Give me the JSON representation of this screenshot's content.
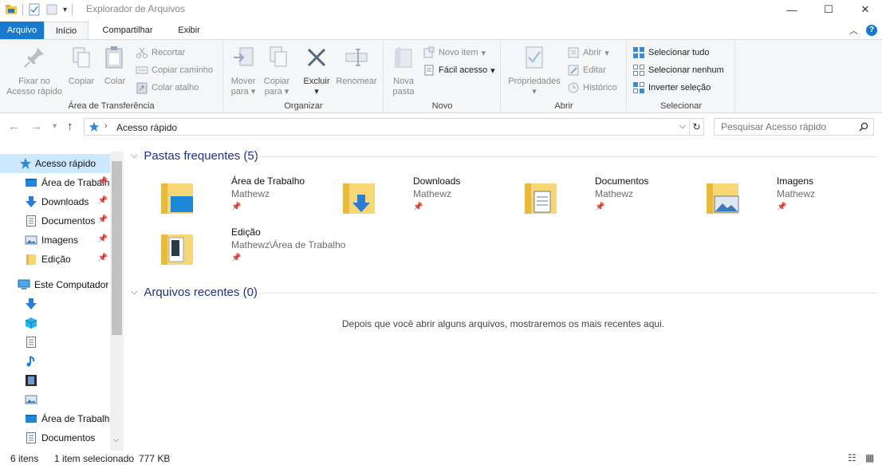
{
  "window": {
    "title": "Explorador de Arquivos",
    "minimize": "—",
    "maximize": "☐",
    "close": "✕"
  },
  "ribbon_tabs": {
    "file": "Arquivo",
    "home": "Início",
    "share": "Compartilhar",
    "view": "Exibir"
  },
  "ribbon": {
    "clipboard": {
      "pin_line1": "Fixar no",
      "pin_line2": "Acesso rápido",
      "copy": "Copiar",
      "paste": "Colar",
      "cut": "Recortar",
      "copy_path": "Copiar caminho",
      "paste_shortcut": "Colar atalho",
      "label": "Área de Transferência"
    },
    "organize": {
      "move_line1": "Mover",
      "move_line2": "para",
      "copyto_line1": "Copiar",
      "copyto_line2": "para",
      "delete": "Excluir",
      "rename": "Renomear",
      "label": "Organizar"
    },
    "new": {
      "new_folder_line1": "Nova",
      "new_folder_line2": "pasta",
      "new_item": "Novo item",
      "easy_access": "Fácil acesso",
      "label": "Novo"
    },
    "open": {
      "properties": "Propriedades",
      "open": "Abrir",
      "edit": "Editar",
      "history": "Histórico",
      "label": "Abrir"
    },
    "select": {
      "select_all": "Selecionar tudo",
      "select_none": "Selecionar nenhum",
      "invert": "Inverter seleção",
      "label": "Selecionar"
    }
  },
  "address": {
    "breadcrumb": "Acesso rápido",
    "search_placeholder": "Pesquisar Acesso rápido"
  },
  "nav_pane": {
    "items": [
      {
        "label": "Acesso rápido",
        "pinned": false,
        "selected": true
      },
      {
        "label": "Área de Trabalho",
        "pinned": true
      },
      {
        "label": "Downloads",
        "pinned": true
      },
      {
        "label": "Documentos",
        "pinned": true
      },
      {
        "label": "Imagens",
        "pinned": true
      },
      {
        "label": "Edição",
        "pinned": true
      },
      {
        "label": "Este Computador",
        "pinned": false
      },
      {
        "label": "Área de Trabalho",
        "pinned": false
      },
      {
        "label": "Documentos",
        "pinned": false
      }
    ]
  },
  "content": {
    "frequent_header": "Pastas frequentes (5)",
    "recent_header": "Arquivos recentes (0)",
    "recent_empty": "Depois que você abrir alguns arquivos, mostraremos os mais recentes aqui.",
    "folders": [
      {
        "name": "Área de Trabalho",
        "path": "Mathewz"
      },
      {
        "name": "Downloads",
        "path": "Mathewz"
      },
      {
        "name": "Documentos",
        "path": "Mathewz"
      },
      {
        "name": "Imagens",
        "path": "Mathewz"
      },
      {
        "name": "Edição",
        "path": "Mathewz\\Área de Trabalho"
      }
    ]
  },
  "status": {
    "count": "6 itens",
    "selection": "1 item selecionado",
    "size": "777 KB"
  },
  "colors": {
    "accent": "#1979ca",
    "selection": "#cce8ff",
    "folder": "#f0c85a",
    "header_text": "#1e3287"
  }
}
